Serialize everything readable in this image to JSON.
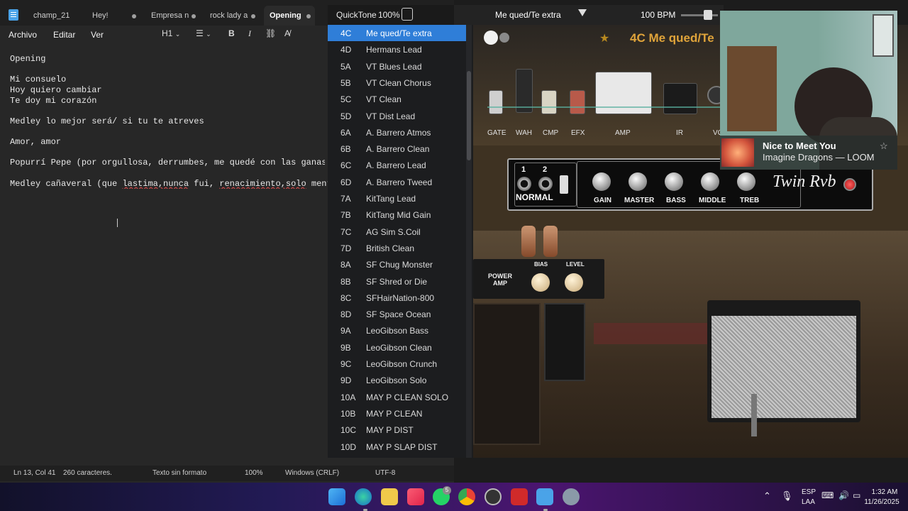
{
  "notepad": {
    "tabs": [
      {
        "label": "champ_21"
      },
      {
        "label": "Hey!"
      },
      {
        "label": "Empresa n"
      },
      {
        "label": "rock lady a"
      },
      {
        "label": "Opening"
      }
    ],
    "menu": [
      "Archivo",
      "Editar",
      "Ver"
    ],
    "toolbar": {
      "heading": "H1",
      "bold": "B",
      "italic": "I"
    },
    "lines": [
      "Opening",
      "",
      "Mi consuelo",
      "Hoy quiero cambiar",
      "Te doy mi corazón",
      "",
      "Medley lo mejor será/ si tu te atreves",
      "",
      "Amor, amor",
      "",
      "Popurrí Pepe (por orgullosa, derrumbes, me quedé con las ganas, te",
      "",
      "Medley cañaveral (que lastima,nunca fui, renacimiento,solo mentiras"
    ],
    "status": {
      "position": "Ln 13, Col 41",
      "chars": "260 caracteres.",
      "format": "Texto sin formato",
      "zoom": "100%",
      "eol": "Windows (CRLF)",
      "encoding": "UTF-8"
    }
  },
  "quicktone": {
    "title": "QuickTone",
    "volume": "100%",
    "current_preset": "Me qued/Te extra",
    "bpm": "100 BPM",
    "presets": [
      {
        "code": "4C",
        "name": "Me qued/Te extra",
        "selected": true
      },
      {
        "code": "4D",
        "name": "Hermans Lead"
      },
      {
        "code": "5A",
        "name": "VT Blues Lead"
      },
      {
        "code": "5B",
        "name": "VT Clean Chorus"
      },
      {
        "code": "5C",
        "name": "VT Clean"
      },
      {
        "code": "5D",
        "name": "VT Dist Lead"
      },
      {
        "code": "6A",
        "name": "A. Barrero Atmos"
      },
      {
        "code": "6B",
        "name": "A. Barrero Clean"
      },
      {
        "code": "6C",
        "name": "A. Barrero Lead"
      },
      {
        "code": "6D",
        "name": "A. Barrero Tweed"
      },
      {
        "code": "7A",
        "name": "KitTang Lead"
      },
      {
        "code": "7B",
        "name": "KitTang Mid Gain"
      },
      {
        "code": "7C",
        "name": "AG Sim S.Coil"
      },
      {
        "code": "7D",
        "name": "British Clean"
      },
      {
        "code": "8A",
        "name": "SF Chug Monster"
      },
      {
        "code": "8B",
        "name": "SF Shred or Die"
      },
      {
        "code": "8C",
        "name": "SFHairNation-800"
      },
      {
        "code": "8D",
        "name": "SF Space Ocean"
      },
      {
        "code": "9A",
        "name": "LeoGibson Bass"
      },
      {
        "code": "9B",
        "name": "LeoGibson Clean"
      },
      {
        "code": "9C",
        "name": "LeoGibson Crunch"
      },
      {
        "code": "9D",
        "name": "LeoGibson Solo"
      },
      {
        "code": "10A",
        "name": "MAY P CLEAN SOLO"
      },
      {
        "code": "10B",
        "name": "MAY P CLEAN"
      },
      {
        "code": "10C",
        "name": "MAY P DIST"
      },
      {
        "code": "10D",
        "name": "MAY P SLAP DIST"
      }
    ]
  },
  "amp": {
    "preset_title": "4C Me qued/Te",
    "rack_labels": [
      "GATE",
      "WAH",
      "CMP",
      "EFX",
      "AMP",
      "IR",
      "VO"
    ],
    "channel": {
      "in1": "1",
      "in2": "2",
      "mode": "NORMAL"
    },
    "knobs": [
      "GAIN",
      "MASTER",
      "BASS",
      "MIDDLE",
      "TREB"
    ],
    "brand": "Twin Rvb",
    "power_amp": {
      "label": "POWER AMP",
      "bias": "BIAS",
      "level": "LEVEL"
    }
  },
  "now_playing": {
    "title": "Nice to Meet You",
    "artist": "Imagine Dragons — LOOM"
  },
  "taskbar": {
    "lang": "ESP",
    "region": "LAA",
    "time": "1:32 AM",
    "date": "11/26/2025",
    "whatsapp_badge": "5"
  }
}
